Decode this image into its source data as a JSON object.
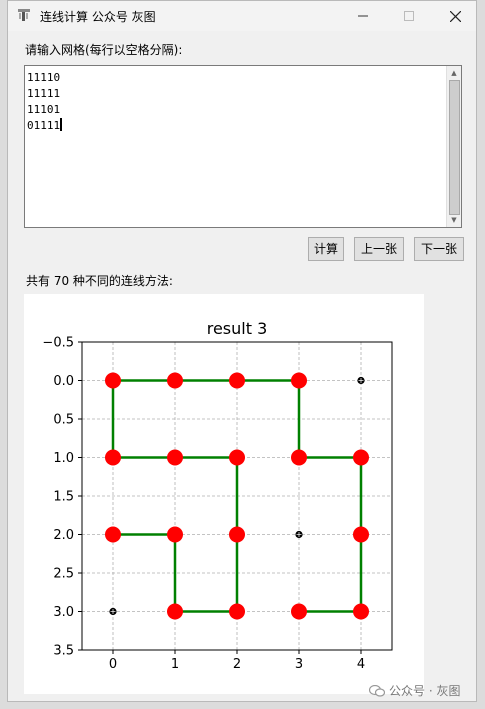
{
  "window": {
    "title": "连线计算 公众号 灰图"
  },
  "prompt": "请输入网格(每行以空格分隔):",
  "input": {
    "lines": [
      "11110",
      "11111",
      "11101",
      "01111"
    ]
  },
  "buttons": {
    "calc": "计算",
    "prev": "上一张",
    "next": "下一张"
  },
  "result_text": "共有 70 种不同的连线方法:",
  "watermark": "公众号 · 灰图",
  "colors": {
    "path": "#008000",
    "node": "#ff0000",
    "blocked": "#000000"
  },
  "chart_data": {
    "type": "scatter",
    "title": "result 3",
    "xlim": [
      -0.5,
      4.5
    ],
    "ylim": [
      3.5,
      -0.5
    ],
    "y_inverted": true,
    "xticks": [
      0,
      1,
      2,
      3,
      4
    ],
    "yticks": [
      -0.5,
      0.0,
      0.5,
      1.0,
      1.5,
      2.0,
      2.5,
      3.0,
      3.5
    ],
    "xtick_labels": [
      "0",
      "1",
      "2",
      "3",
      "4"
    ],
    "ytick_labels": [
      "−0.5",
      "0.0",
      "0.5",
      "1.0",
      "1.5",
      "2.0",
      "2.5",
      "3.0",
      "3.5"
    ],
    "grid": true,
    "path": [
      [
        0,
        2
      ],
      [
        1,
        2
      ],
      [
        1,
        3
      ],
      [
        2,
        3
      ],
      [
        2,
        2
      ],
      [
        2,
        1
      ],
      [
        1,
        1
      ],
      [
        0,
        1
      ],
      [
        0,
        0
      ],
      [
        1,
        0
      ],
      [
        2,
        0
      ],
      [
        3,
        0
      ],
      [
        3,
        1
      ],
      [
        4,
        1
      ],
      [
        4,
        2
      ],
      [
        4,
        3
      ],
      [
        3,
        3
      ]
    ],
    "blocked": [
      [
        4,
        0
      ],
      [
        3,
        2
      ],
      [
        0,
        3
      ]
    ]
  }
}
